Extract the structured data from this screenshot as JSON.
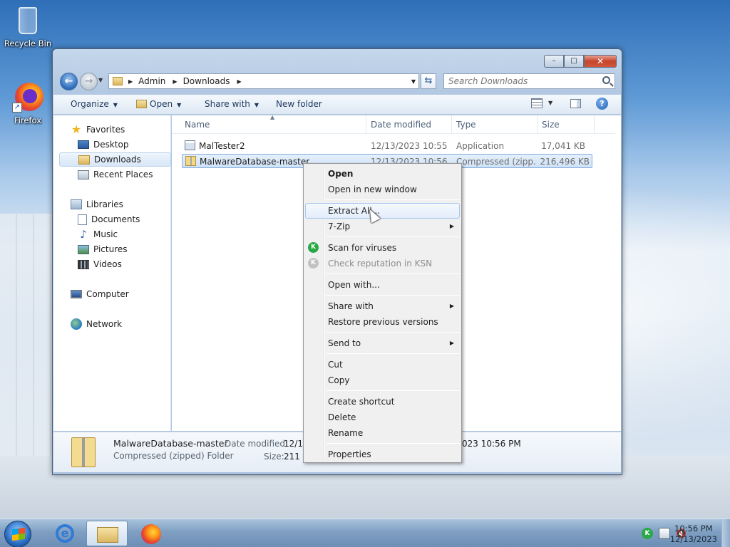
{
  "desktop": {
    "icons": [
      {
        "label": "Recycle Bin",
        "icon": "recycle-bin-icon"
      },
      {
        "label": "Firefox",
        "icon": "firefox-icon"
      }
    ]
  },
  "window": {
    "caption_buttons": {
      "minimize": "–",
      "maximize": "□",
      "close": "✕"
    },
    "address": {
      "segments": [
        "Admin",
        "Downloads"
      ]
    },
    "search": {
      "placeholder": "Search Downloads"
    },
    "toolbar": {
      "organize": "Organize",
      "open": "Open",
      "share_with": "Share with",
      "new_folder": "New folder"
    },
    "nav": {
      "favorites": "Favorites",
      "desktop": "Desktop",
      "downloads": "Downloads",
      "recent_places": "Recent Places",
      "libraries": "Libraries",
      "documents": "Documents",
      "music": "Music",
      "pictures": "Pictures",
      "videos": "Videos",
      "computer": "Computer",
      "network": "Network"
    },
    "columns": {
      "name": "Name",
      "date": "Date modified",
      "type": "Type",
      "size": "Size"
    },
    "files": [
      {
        "name": "MalTester2",
        "date": "12/13/2023 10:55 ...",
        "type": "Application",
        "size": "17,041 KB",
        "icon": "application-icon"
      },
      {
        "name": "MalwareDatabase-master",
        "date": "12/13/2023 10:56 ...",
        "type": "Compressed (zipp...",
        "size": "216,496 KB",
        "icon": "zip-folder-icon",
        "selected": true
      }
    ],
    "details": {
      "name": "MalwareDatabase-master",
      "type": "Compressed (zipped) Folder",
      "date_label": "Date modified:",
      "date_value_visible": "12/13",
      "date_value_tail": "023 10:56 PM",
      "size_label": "Size:",
      "size_value_visible": "211 M"
    }
  },
  "context_menu": {
    "items": [
      {
        "label": "Open",
        "bold": true
      },
      {
        "label": "Open in new window"
      },
      {
        "label": "Extract All...",
        "highlighted": true
      },
      {
        "label": "7-Zip",
        "submenu": true
      },
      {
        "label": "Scan for viruses",
        "icon": "kaspersky-k-icon"
      },
      {
        "label": "Check reputation in KSN",
        "icon": "kaspersky-k-icon",
        "disabled": true
      },
      {
        "label": "Open with..."
      },
      {
        "label": "Share with",
        "submenu": true
      },
      {
        "label": "Restore previous versions"
      },
      {
        "label": "Send to",
        "submenu": true
      },
      {
        "label": "Cut"
      },
      {
        "label": "Copy"
      },
      {
        "label": "Create shortcut"
      },
      {
        "label": "Delete"
      },
      {
        "label": "Rename"
      },
      {
        "label": "Properties"
      }
    ]
  },
  "taskbar": {
    "time": "10:56 PM",
    "date": "12/13/2023",
    "tray_icons": [
      "kaspersky-k-icon",
      "action-center-flag-icon",
      "speaker-muted-icon"
    ]
  }
}
